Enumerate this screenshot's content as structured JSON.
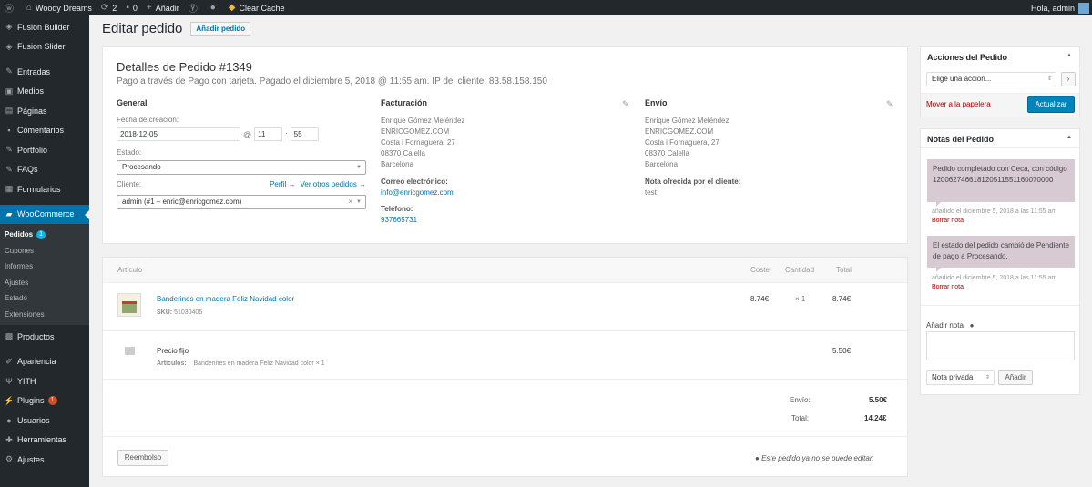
{
  "adminbar": {
    "site": "Woody Dreams",
    "updates": "2",
    "comments": "0",
    "add": "Añadir",
    "clear_cache": "Clear Cache",
    "greeting": "Hola, admin"
  },
  "sidebar": {
    "items": [
      {
        "label": "Fusion Builder",
        "icon": "fusion-icon"
      },
      {
        "label": "Fusion Slider",
        "icon": "fusion-icon"
      },
      {
        "label": "Entradas",
        "icon": "pin-icon"
      },
      {
        "label": "Medios",
        "icon": "media-icon"
      },
      {
        "label": "Páginas",
        "icon": "page-icon"
      },
      {
        "label": "Comentarios",
        "icon": "comment-icon"
      },
      {
        "label": "Portfolio",
        "icon": "pin-icon"
      },
      {
        "label": "FAQs",
        "icon": "pin-icon"
      },
      {
        "label": "Formularios",
        "icon": "form-icon"
      },
      {
        "label": "WooCommerce",
        "icon": "woo-icon"
      }
    ],
    "submenu": [
      {
        "label": "Pedidos",
        "badge": "1"
      },
      {
        "label": "Cupones"
      },
      {
        "label": "Informes"
      },
      {
        "label": "Ajustes"
      },
      {
        "label": "Estado"
      },
      {
        "label": "Extensiones"
      }
    ],
    "items2": [
      {
        "label": "Productos",
        "icon": "product-icon"
      },
      {
        "label": "Apariencia",
        "icon": "brush-icon"
      },
      {
        "label": "YITH",
        "icon": "yith-icon"
      },
      {
        "label": "Plugins",
        "icon": "plugin-icon",
        "badge": "1"
      },
      {
        "label": "Usuarios",
        "icon": "user-icon"
      },
      {
        "label": "Herramientas",
        "icon": "tool-icon"
      },
      {
        "label": "Ajustes",
        "icon": "settings-icon"
      }
    ]
  },
  "page": {
    "title": "Editar pedido",
    "add_button": "Añadir pedido"
  },
  "order": {
    "title": "Detalles de Pedido #1349",
    "subtitle": "Pago a través de Pago con tarjeta. Pagado el diciembre 5, 2018 @ 11:55 am. IP del cliente: 83.58.158.150",
    "general": {
      "heading": "General",
      "date_label": "Fecha de creación:",
      "date": "2018-12-05",
      "at": "@",
      "hour": "11",
      "colon": ":",
      "minute": "55",
      "status_label": "Estado:",
      "status": "Procesando",
      "client_label": "Cliente:",
      "profile_link": "Perfil →",
      "other_orders_link": "Ver otros pedidos →",
      "client": "admin (#1 – enric@enricgomez.com)"
    },
    "billing": {
      "heading": "Facturación",
      "lines": [
        "Enrique Gómez Meléndez",
        "ENRICGOMEZ.COM",
        "Costa i Fornaguera, 27",
        "08370 Calella",
        "Barcelona"
      ],
      "email_label": "Correo electrónico:",
      "email": "info@enricgomez.com",
      "phone_label": "Teléfono:",
      "phone": "937665731"
    },
    "shipping": {
      "heading": "Envío",
      "lines": [
        "Enrique Gómez Meléndez",
        "ENRICGOMEZ.COM",
        "Costa i Fornaguera, 27",
        "08370 Calella",
        "Barcelona"
      ],
      "note_label": "Nota ofrecida por el cliente:",
      "note": "test"
    }
  },
  "items": {
    "headers": {
      "item": "Artículo",
      "cost": "Coste",
      "qty": "Cantidad",
      "total": "Total"
    },
    "product": {
      "name": "Banderines en madera Feliz Navidad color",
      "sku_label": "SKU:",
      "sku": "51030405",
      "cost": "8.74€",
      "qty": "× 1",
      "total": "8.74€"
    },
    "shipping": {
      "name": "Precio fijo",
      "items_label": "Artículos:",
      "items": "Banderines en madera Feliz Navidad color × 1",
      "total": "5.50€"
    },
    "totals": {
      "ship_label": "Envío:",
      "ship": "5.50€",
      "total_label": "Total:",
      "total": "14.24€"
    },
    "refund_button": "Reembolso",
    "notice": "Este pedido ya no se puede editar."
  },
  "actions": {
    "heading": "Acciones del Pedido",
    "select": "Elige una acción...",
    "trash": "Mover a la papelera",
    "update": "Actualizar"
  },
  "notes": {
    "heading": "Notas del Pedido",
    "list": [
      {
        "text": "Pedido completado con Ceca, con código 120062746618120511551160070000",
        "meta": "añadido el diciembre 5, 2018 a las 11:55 am",
        "delete": "Borrar nota"
      },
      {
        "text": "El estado del pedido cambió de Pendiente de pago a Procesando.",
        "meta": "añadido el diciembre 5, 2018 a las 11:55 am",
        "delete": "Borrar nota"
      }
    ],
    "add_label": "Añadir nota",
    "note_type": "Nota privada",
    "add_button": "Añadir"
  }
}
